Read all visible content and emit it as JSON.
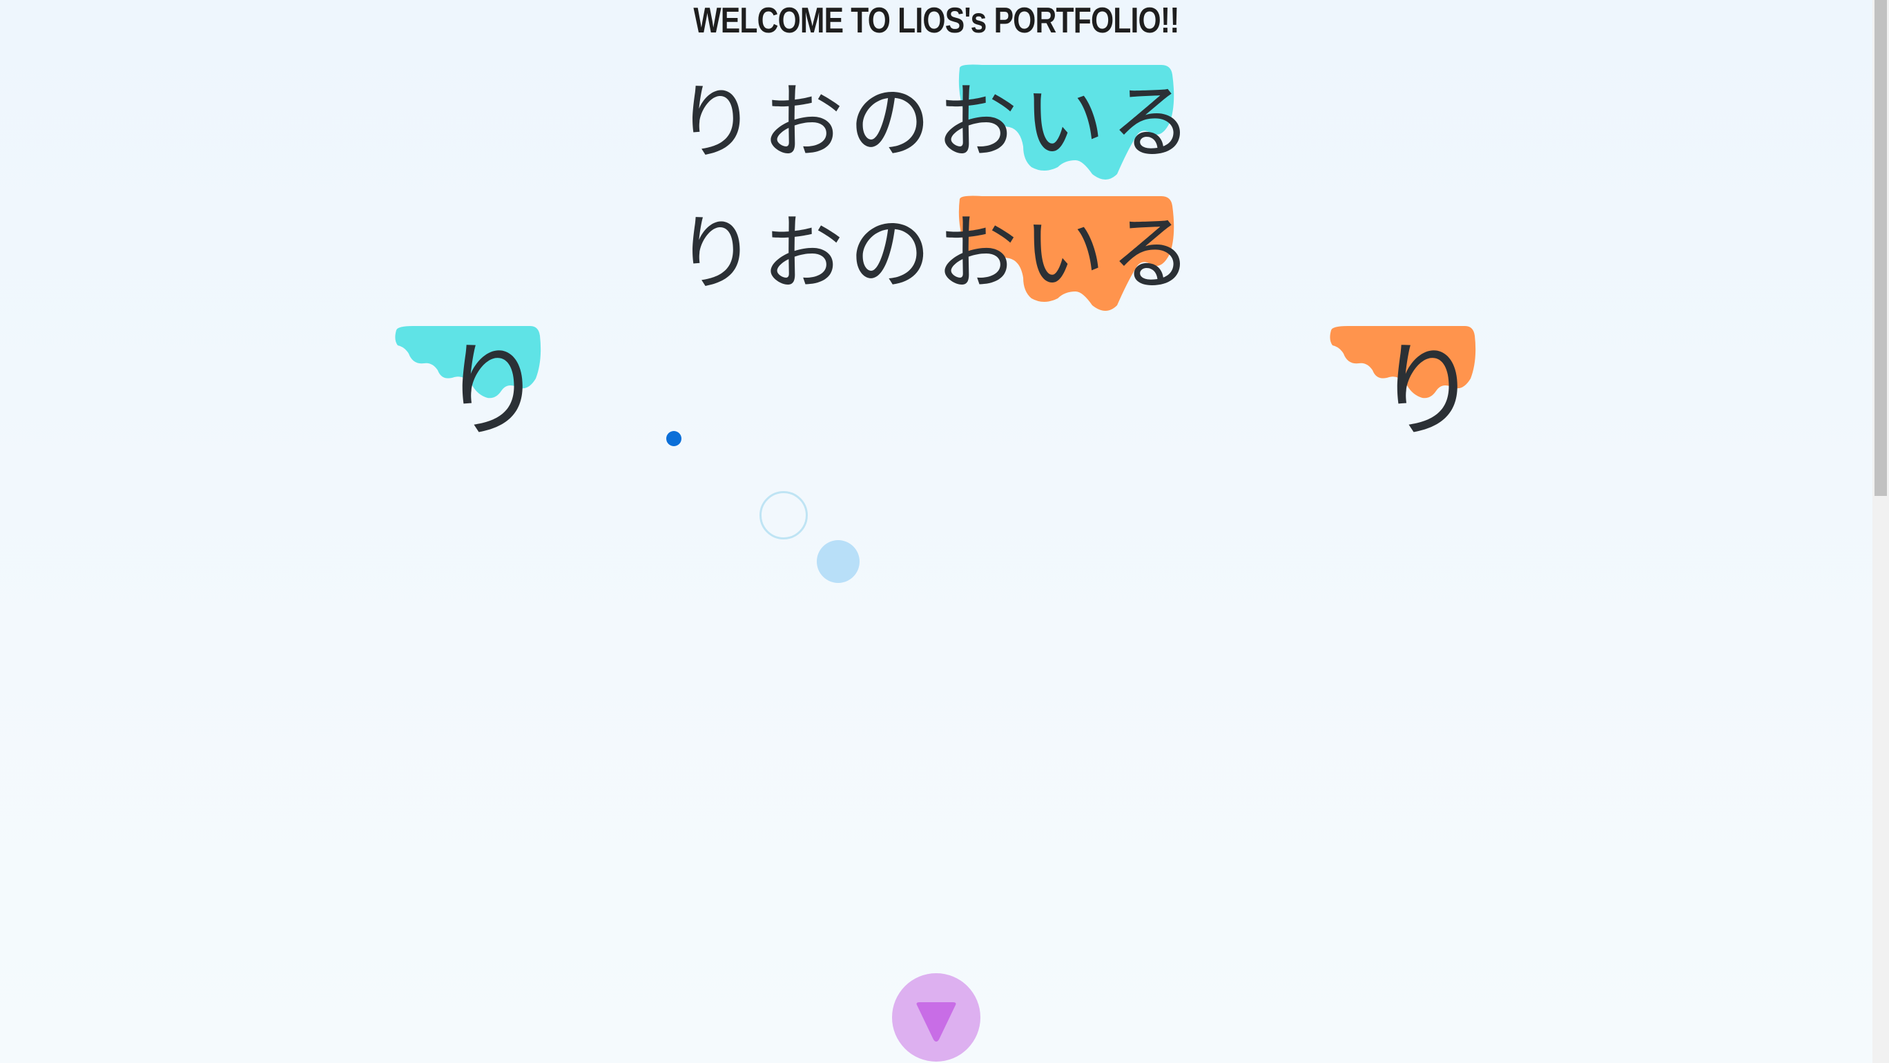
{
  "header": {
    "welcome_text": "WELCOME TO LIOS's PORTFOLIO!!"
  },
  "titles": [
    {
      "text": "りおのおいる",
      "paint_color": "#5fe3e6"
    },
    {
      "text": "りおのおいる",
      "paint_color": "#ff944d"
    }
  ],
  "side_marks": [
    {
      "text": "り",
      "paint_color": "#5fe3e6"
    },
    {
      "text": "り",
      "paint_color": "#ff944d"
    }
  ],
  "decor": {
    "dot_color": "#0b6fd8",
    "ring_color": "#bfe4f4",
    "bubble_color": "#b8dff8"
  },
  "scroll_button": {
    "icon": "triangle-down-icon",
    "bg_color": "#ddb0f0",
    "icon_color": "#c86de6"
  }
}
